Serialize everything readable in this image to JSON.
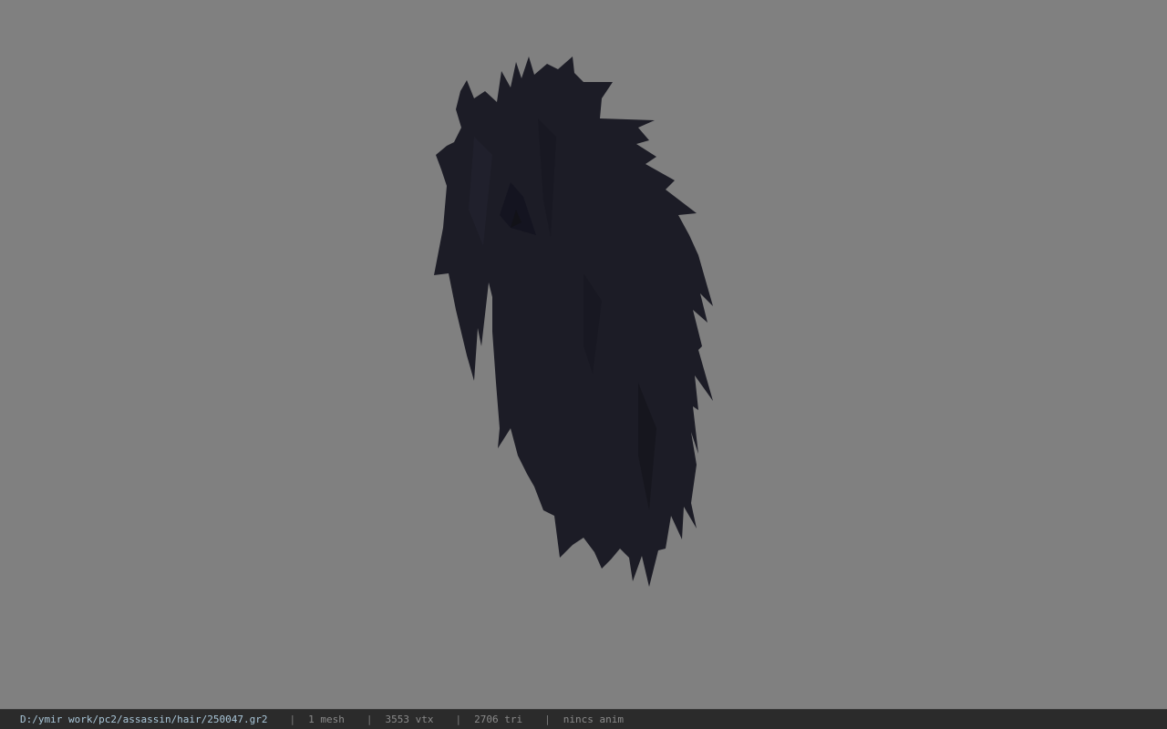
{
  "viewport": {
    "background": "#808080",
    "model_color": "#1c1c26",
    "model_shade": "#10101a"
  },
  "status_bar": {
    "path": "D:/ymir work/pc2/assassin/hair/250047.gr2",
    "separator": "|",
    "mesh_count": "1 mesh",
    "vertex_count": "3553 vtx",
    "triangle_count": "2706 tri",
    "anim_status": "nincs anim"
  }
}
